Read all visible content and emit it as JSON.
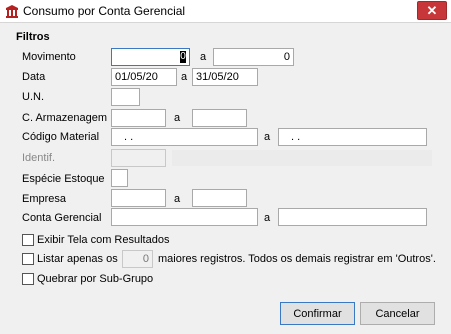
{
  "window": {
    "title": "Consumo por Conta Gerencial",
    "close_glyph": "✕",
    "app_icon": "building-app-icon"
  },
  "group": {
    "title": "Filtros"
  },
  "fields": {
    "movimento_label": "Movimento",
    "movimento_from": "0",
    "movimento_a": "a",
    "movimento_to": "0",
    "data_label": "Data",
    "data_from": "01/05/20",
    "data_a": "a",
    "data_to": "31/05/20",
    "un_label": "U.N.",
    "un_value": "",
    "armazenagem_label": "C. Armazenagem",
    "armazenagem_from": "",
    "armazenagem_a": "a",
    "armazenagem_to": "",
    "material_label": "Código Material",
    "material_from": ". .",
    "material_a": "a",
    "material_to": ". .",
    "identif_label": "Identif.",
    "especie_label": "Espécie Estoque",
    "empresa_label": "Empresa",
    "empresa_from": "",
    "empresa_a": "a",
    "empresa_to": "",
    "conta_label": "Conta Gerencial",
    "conta_from": "",
    "conta_a": "a",
    "conta_to": ""
  },
  "options": {
    "exibir_label": "Exibir Tela com Resultados",
    "listar_prefix": "Listar apenas os",
    "listar_value": "0",
    "listar_suffix": "maiores registros. Todos os demais registrar em 'Outros'.",
    "quebrar_label": "Quebrar por Sub-Grupo"
  },
  "buttons": {
    "confirmar": "Confirmar",
    "cancelar": "Cancelar"
  },
  "colors": {
    "close": "#c7373a",
    "focus": "#3a78c4",
    "icon": "#b52020"
  }
}
